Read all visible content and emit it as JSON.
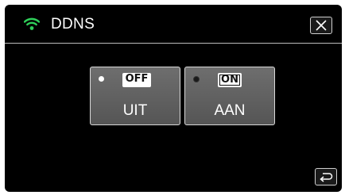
{
  "header": {
    "title": "DDNS",
    "wifi_icon": "wifi-icon",
    "close_icon": "close-icon",
    "accent_color": "#2fd05a"
  },
  "options": [
    {
      "badge": "OFF",
      "label": "UIT",
      "selected": false
    },
    {
      "badge": "ON",
      "label": "AAN",
      "selected": true
    }
  ],
  "footer": {
    "back_icon": "back-arrow-icon"
  }
}
